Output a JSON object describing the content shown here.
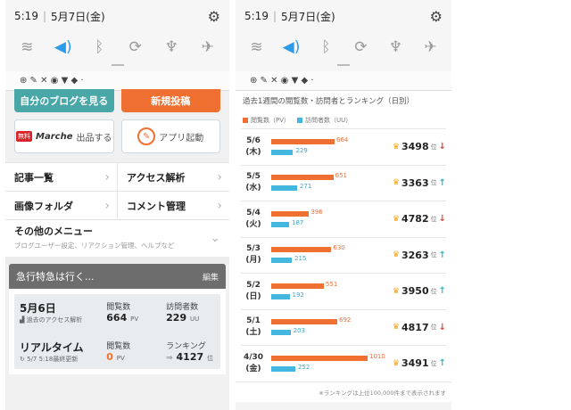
{
  "status": {
    "time": "5:19",
    "date": "5月7日(金)",
    "settings_icon": "gear-icon"
  },
  "quick_settings": [
    "wifi-icon",
    "sound-icon",
    "bluetooth-icon",
    "rotate-icon",
    "flashlight-icon",
    "airplane-icon"
  ],
  "notif_icons": "⊕ ✎ ✕ ◉ ▼ ◆ ·",
  "left": {
    "btn_blog": "自分のブログを見る",
    "btn_new": "新規投稿",
    "marche_badge": "無料",
    "marche_logo": "Marche",
    "marche_label": "出品する",
    "app_label": "アプリ起動",
    "menu": [
      {
        "a": "記事一覧",
        "b": "アクセス解析"
      },
      {
        "a": "画像フォルダ",
        "b": "コメント管理"
      }
    ],
    "other_title": "その他のメニュー",
    "other_sub": "ブログユーザー設定、リアクション管理、ヘルプなど",
    "card_title": "急行特急は行く...",
    "card_edit": "編集",
    "stats": {
      "date": "5月6日",
      "date_sub": "過去のアクセス解析",
      "pv_label": "閲覧数",
      "pv_value": "664",
      "pv_unit": "PV",
      "uu_label": "訪問者数",
      "uu_value": "229",
      "uu_unit": "UU",
      "rt_title": "リアルタイム",
      "rt_sub": "5/7 5:18最終更新",
      "rt_pv_label": "閲覧数",
      "rt_pv_value": "0",
      "rt_pv_unit": "PV",
      "rank_label": "ランキング",
      "rank_value": "4127",
      "rank_unit": "位"
    }
  },
  "right": {
    "title": "過去1週間の閲覧数・訪問者とランキング（日別）",
    "legend_pv": "閲覧数（PV）",
    "legend_uu": "訪問者数（UU）",
    "rank_unit": "位",
    "footnote": "※ランキングは上位100,000件まで表示されます",
    "colors": {
      "pv": "#f07031",
      "uu": "#43b7e0"
    }
  },
  "chart_data": {
    "type": "bar",
    "categories": [
      "5/6",
      "5/5",
      "5/4",
      "5/3",
      "5/2",
      "5/1",
      "4/30"
    ],
    "weekdays": [
      "(木)",
      "(水)",
      "(火)",
      "(月)",
      "(日)",
      "(土)",
      "(金)"
    ],
    "series": [
      {
        "name": "閲覧数（PV）",
        "values": [
          664,
          651,
          396,
          630,
          551,
          692,
          1010
        ]
      },
      {
        "name": "訪問者数（UU）",
        "values": [
          229,
          271,
          187,
          215,
          192,
          203,
          252
        ]
      }
    ],
    "ranking": [
      3498,
      3363,
      4782,
      3263,
      3950,
      4817,
      3491
    ],
    "trend": [
      "down",
      "up",
      "down",
      "up",
      "up",
      "down",
      "up"
    ],
    "max": 1010
  }
}
